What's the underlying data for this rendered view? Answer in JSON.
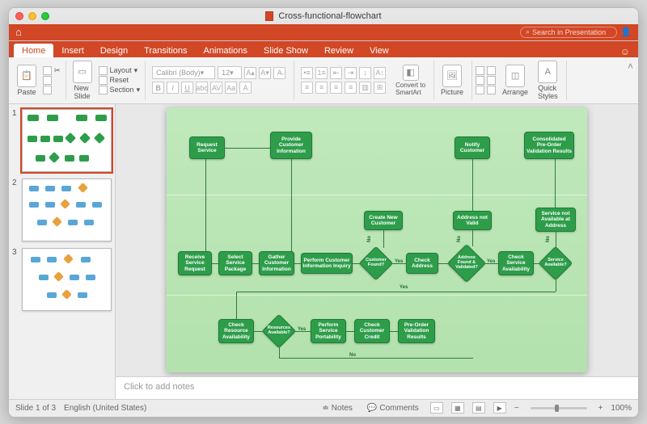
{
  "window": {
    "title": "Cross-functional-flowchart"
  },
  "topmenu": {
    "search_placeholder": "Search in Presentation"
  },
  "tabs": [
    "Home",
    "Insert",
    "Design",
    "Transitions",
    "Animations",
    "Slide Show",
    "Review",
    "View"
  ],
  "ribbon": {
    "paste": "Paste",
    "new_slide": "New\nSlide",
    "layout": "Layout",
    "reset": "Reset",
    "section": "Section",
    "font_name": "Calibri (Body)",
    "font_size": "12",
    "convert": "Convert to\nSmartArt",
    "picture": "Picture",
    "arrange": "Arrange",
    "quick_styles": "Quick\nStyles"
  },
  "slides": {
    "count": 3,
    "current": 1
  },
  "flow": {
    "r1": {
      "request": "Request\nService",
      "provide": "Provide\nCustomer\nInformation",
      "notify": "Notify\nCustomer",
      "consolidated": "Consolidated\nPre-Order\nValidation Results"
    },
    "r2_upper": {
      "create_new": "Create New\nCustomer",
      "addr_not_valid": "Address not\nValid",
      "svc_not_avail": "Service not\nAvailable at\nAddress"
    },
    "r2": {
      "receive": "Receive\nService\nRequest",
      "select": "Select\nService\nPackage",
      "gather": "Gather\nCustomer\nInformation",
      "perform_inquiry": "Perform Customer\nInformation Inquiry",
      "customer_found": "Customer\nFound?",
      "check_address": "Check\nAddress",
      "address_valid": "Address\nFound &\nValidated?",
      "check_svc": "Check\nService\nAvailability",
      "svc_avail": "Service\nAvailable?"
    },
    "r3": {
      "check_res": "Check\nResource\nAvailability",
      "res_avail": "Resources\nAvailable?",
      "perform_port": "Perform\nService\nPortability",
      "check_credit": "Check\nCustomer\nCredit",
      "preorder": "Pre-Order\nValidation\nResults"
    },
    "labels": {
      "yes": "Yes",
      "no": "No"
    }
  },
  "notes": {
    "placeholder": "Click to add notes"
  },
  "status": {
    "slide_info": "Slide 1 of 3",
    "lang": "English (United States)",
    "notes": "Notes",
    "comments": "Comments",
    "zoom": "100%"
  }
}
